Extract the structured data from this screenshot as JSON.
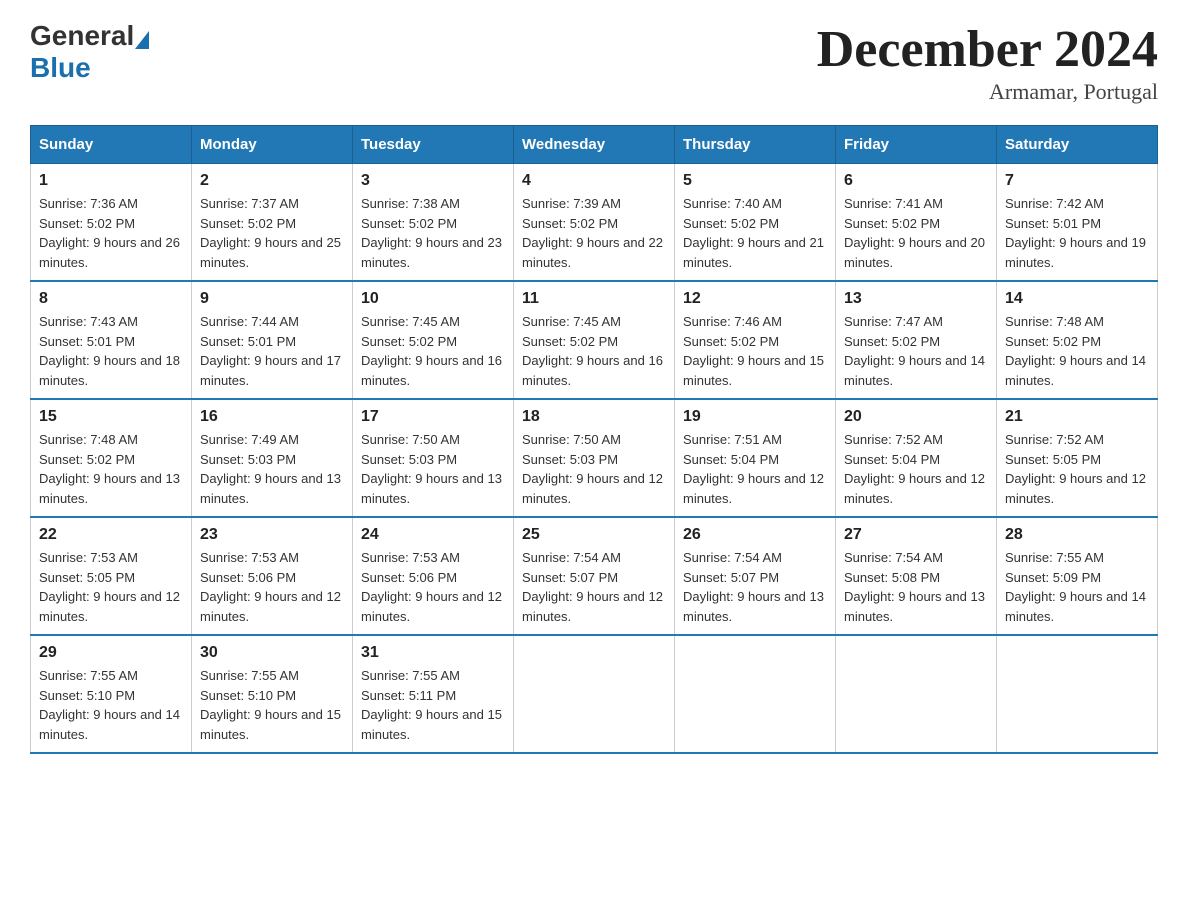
{
  "header": {
    "logo_general": "General",
    "logo_blue": "Blue",
    "title": "December 2024",
    "subtitle": "Armamar, Portugal"
  },
  "days_of_week": [
    "Sunday",
    "Monday",
    "Tuesday",
    "Wednesday",
    "Thursday",
    "Friday",
    "Saturday"
  ],
  "weeks": [
    [
      {
        "day": "1",
        "sunrise": "7:36 AM",
        "sunset": "5:02 PM",
        "daylight": "9 hours and 26 minutes."
      },
      {
        "day": "2",
        "sunrise": "7:37 AM",
        "sunset": "5:02 PM",
        "daylight": "9 hours and 25 minutes."
      },
      {
        "day": "3",
        "sunrise": "7:38 AM",
        "sunset": "5:02 PM",
        "daylight": "9 hours and 23 minutes."
      },
      {
        "day": "4",
        "sunrise": "7:39 AM",
        "sunset": "5:02 PM",
        "daylight": "9 hours and 22 minutes."
      },
      {
        "day": "5",
        "sunrise": "7:40 AM",
        "sunset": "5:02 PM",
        "daylight": "9 hours and 21 minutes."
      },
      {
        "day": "6",
        "sunrise": "7:41 AM",
        "sunset": "5:02 PM",
        "daylight": "9 hours and 20 minutes."
      },
      {
        "day": "7",
        "sunrise": "7:42 AM",
        "sunset": "5:01 PM",
        "daylight": "9 hours and 19 minutes."
      }
    ],
    [
      {
        "day": "8",
        "sunrise": "7:43 AM",
        "sunset": "5:01 PM",
        "daylight": "9 hours and 18 minutes."
      },
      {
        "day": "9",
        "sunrise": "7:44 AM",
        "sunset": "5:01 PM",
        "daylight": "9 hours and 17 minutes."
      },
      {
        "day": "10",
        "sunrise": "7:45 AM",
        "sunset": "5:02 PM",
        "daylight": "9 hours and 16 minutes."
      },
      {
        "day": "11",
        "sunrise": "7:45 AM",
        "sunset": "5:02 PM",
        "daylight": "9 hours and 16 minutes."
      },
      {
        "day": "12",
        "sunrise": "7:46 AM",
        "sunset": "5:02 PM",
        "daylight": "9 hours and 15 minutes."
      },
      {
        "day": "13",
        "sunrise": "7:47 AM",
        "sunset": "5:02 PM",
        "daylight": "9 hours and 14 minutes."
      },
      {
        "day": "14",
        "sunrise": "7:48 AM",
        "sunset": "5:02 PM",
        "daylight": "9 hours and 14 minutes."
      }
    ],
    [
      {
        "day": "15",
        "sunrise": "7:48 AM",
        "sunset": "5:02 PM",
        "daylight": "9 hours and 13 minutes."
      },
      {
        "day": "16",
        "sunrise": "7:49 AM",
        "sunset": "5:03 PM",
        "daylight": "9 hours and 13 minutes."
      },
      {
        "day": "17",
        "sunrise": "7:50 AM",
        "sunset": "5:03 PM",
        "daylight": "9 hours and 13 minutes."
      },
      {
        "day": "18",
        "sunrise": "7:50 AM",
        "sunset": "5:03 PM",
        "daylight": "9 hours and 12 minutes."
      },
      {
        "day": "19",
        "sunrise": "7:51 AM",
        "sunset": "5:04 PM",
        "daylight": "9 hours and 12 minutes."
      },
      {
        "day": "20",
        "sunrise": "7:52 AM",
        "sunset": "5:04 PM",
        "daylight": "9 hours and 12 minutes."
      },
      {
        "day": "21",
        "sunrise": "7:52 AM",
        "sunset": "5:05 PM",
        "daylight": "9 hours and 12 minutes."
      }
    ],
    [
      {
        "day": "22",
        "sunrise": "7:53 AM",
        "sunset": "5:05 PM",
        "daylight": "9 hours and 12 minutes."
      },
      {
        "day": "23",
        "sunrise": "7:53 AM",
        "sunset": "5:06 PM",
        "daylight": "9 hours and 12 minutes."
      },
      {
        "day": "24",
        "sunrise": "7:53 AM",
        "sunset": "5:06 PM",
        "daylight": "9 hours and 12 minutes."
      },
      {
        "day": "25",
        "sunrise": "7:54 AM",
        "sunset": "5:07 PM",
        "daylight": "9 hours and 12 minutes."
      },
      {
        "day": "26",
        "sunrise": "7:54 AM",
        "sunset": "5:07 PM",
        "daylight": "9 hours and 13 minutes."
      },
      {
        "day": "27",
        "sunrise": "7:54 AM",
        "sunset": "5:08 PM",
        "daylight": "9 hours and 13 minutes."
      },
      {
        "day": "28",
        "sunrise": "7:55 AM",
        "sunset": "5:09 PM",
        "daylight": "9 hours and 14 minutes."
      }
    ],
    [
      {
        "day": "29",
        "sunrise": "7:55 AM",
        "sunset": "5:10 PM",
        "daylight": "9 hours and 14 minutes."
      },
      {
        "day": "30",
        "sunrise": "7:55 AM",
        "sunset": "5:10 PM",
        "daylight": "9 hours and 15 minutes."
      },
      {
        "day": "31",
        "sunrise": "7:55 AM",
        "sunset": "5:11 PM",
        "daylight": "9 hours and 15 minutes."
      },
      null,
      null,
      null,
      null
    ]
  ],
  "labels": {
    "sunrise": "Sunrise:",
    "sunset": "Sunset:",
    "daylight": "Daylight:"
  }
}
